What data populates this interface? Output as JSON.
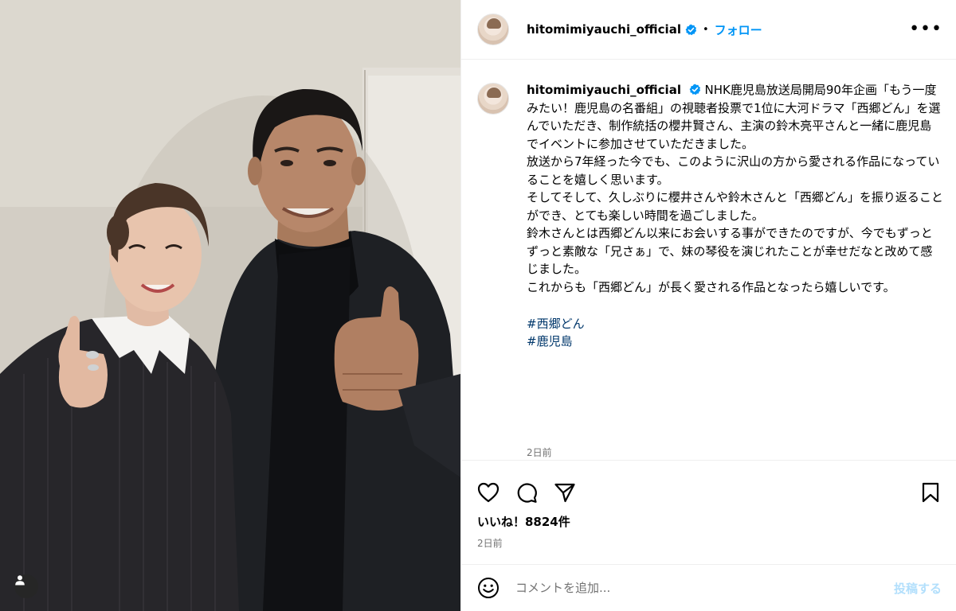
{
  "post": {
    "username": "hitomimiyauchi_official",
    "follow_label": "フォロー",
    "separator": "•",
    "more_label": "•••",
    "caption": {
      "username": "hitomimiyauchi_official",
      "paragraphs": [
        "NHK鹿児島放送局開局90年企画「もう一度みたい！鹿児島の名番組」の視聴者投票で1位に大河ドラマ「西郷どん」を選んでいただき、制作統括の櫻井賢さん、主演の鈴木亮平さんと一緒に鹿児島でイベントに参加させていただきました。",
        "放送から7年経った今でも、このように沢山の方から愛される作品になっていることを嬉しく思います。",
        "そしてそして、久しぶりに櫻井さんや鈴木さんと「西郷どん」を振り返ることができ、とても楽しい時間を過ごしました。",
        "鈴木さんとは西郷どん以来にお会いする事ができたのですが、今でもずっとずっと素敵な「兄さぁ」で、妹の琴役を演じれたことが幸せだなと改めて感じました。",
        "これからも「西郷どん」が長く愛される作品となったら嬉しいです。"
      ],
      "hashtags": [
        "#西郷どん",
        "#鹿児島"
      ],
      "time": "2日前"
    },
    "likes": "いいね！8824件",
    "time": "2日前",
    "icons": {
      "like": "heart-icon",
      "comment": "comment-bubble-icon",
      "share": "paper-plane-icon",
      "save": "bookmark-icon",
      "emoji": "smiley-icon",
      "tag": "user-tag-icon",
      "verified": "verified-badge-icon"
    }
  },
  "comment": {
    "placeholder": "コメントを追加...",
    "post_label": "投稿する"
  },
  "colors": {
    "link": "#0095f6",
    "hashtag": "#00376b",
    "muted": "#737373",
    "post_disabled": "#b2dffc"
  }
}
